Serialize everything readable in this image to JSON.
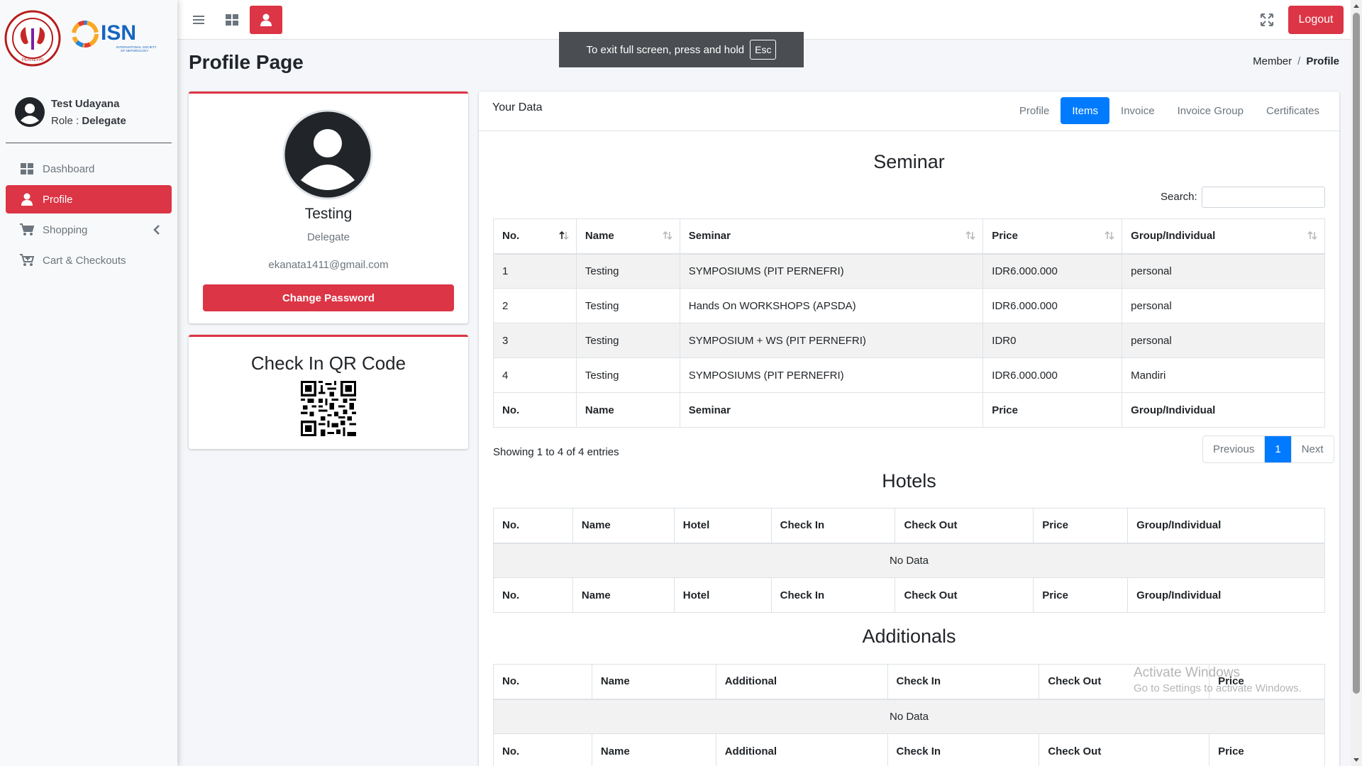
{
  "app": {
    "logo_pernefri_text": "PERHIMPUNAN NEFROLOGI INDONESIA PERNEFRI",
    "logo_isn_text": "ISN",
    "logo_isn_subtitle": "INTERNATIONAL SOCIETY OF NEPHROLOGY"
  },
  "user": {
    "name": "Test Udayana",
    "role_prefix": "Role : ",
    "role": "Delegate"
  },
  "sidebar": {
    "items": [
      {
        "label": "Dashboard",
        "icon": "dashboard-icon",
        "active": false
      },
      {
        "label": "Profile",
        "icon": "user-icon",
        "active": true
      },
      {
        "label": "Shopping",
        "icon": "cart-icon",
        "active": false,
        "has_submenu": true
      },
      {
        "label": "Cart & Checkouts",
        "icon": "cart-plus-icon",
        "active": false
      }
    ]
  },
  "topbar": {
    "logout_label": "Logout"
  },
  "toast": {
    "text": "To exit full screen, press and hold",
    "key": "Esc"
  },
  "header": {
    "title": "Profile Page",
    "breadcrumb": [
      "Member",
      "Profile"
    ],
    "breadcrumb_sep": "/"
  },
  "profile_card": {
    "name": "Testing",
    "role": "Delegate",
    "email": "ekanata1411@gmail.com",
    "change_password_label": "Change Password"
  },
  "qr_card": {
    "title": "Check In QR Code"
  },
  "data_card": {
    "title": "Your Data",
    "tabs": [
      "Profile",
      "Items",
      "Invoice",
      "Invoice Group",
      "Certificates"
    ],
    "active_tab": "Items"
  },
  "seminar": {
    "title": "Seminar",
    "search_label": "Search:",
    "columns": [
      "No.",
      "Name",
      "Seminar",
      "Price",
      "Group/Individual"
    ],
    "rows": [
      [
        "1",
        "Testing",
        "SYMPOSIUMS (PIT PERNEFRI)",
        "IDR6.000.000",
        "personal"
      ],
      [
        "2",
        "Testing",
        "Hands On WORKSHOPS (APSDA)",
        "IDR6.000.000",
        "personal"
      ],
      [
        "3",
        "Testing",
        "SYMPOSIUM + WS (PIT PERNEFRI)",
        "IDR0",
        "personal"
      ],
      [
        "4",
        "Testing",
        "SYMPOSIUMS (PIT PERNEFRI)",
        "IDR6.000.000",
        "Mandiri"
      ]
    ],
    "info": "Showing 1 to 4 of 4 entries",
    "pager": {
      "previous": "Previous",
      "current": "1",
      "next": "Next"
    }
  },
  "hotels": {
    "title": "Hotels",
    "columns": [
      "No.",
      "Name",
      "Hotel",
      "Check In",
      "Check Out",
      "Price",
      "Group/Individual"
    ],
    "empty": "No Data"
  },
  "additionals": {
    "title": "Additionals",
    "columns": [
      "No.",
      "Name",
      "Additional",
      "Check In",
      "Check Out",
      "Price"
    ],
    "empty": "No Data"
  },
  "watermark": {
    "line1": "Activate Windows",
    "line2": "Go to Settings to activate Windows."
  },
  "colors": {
    "accent": "#dc3545",
    "primary": "#007bff"
  }
}
